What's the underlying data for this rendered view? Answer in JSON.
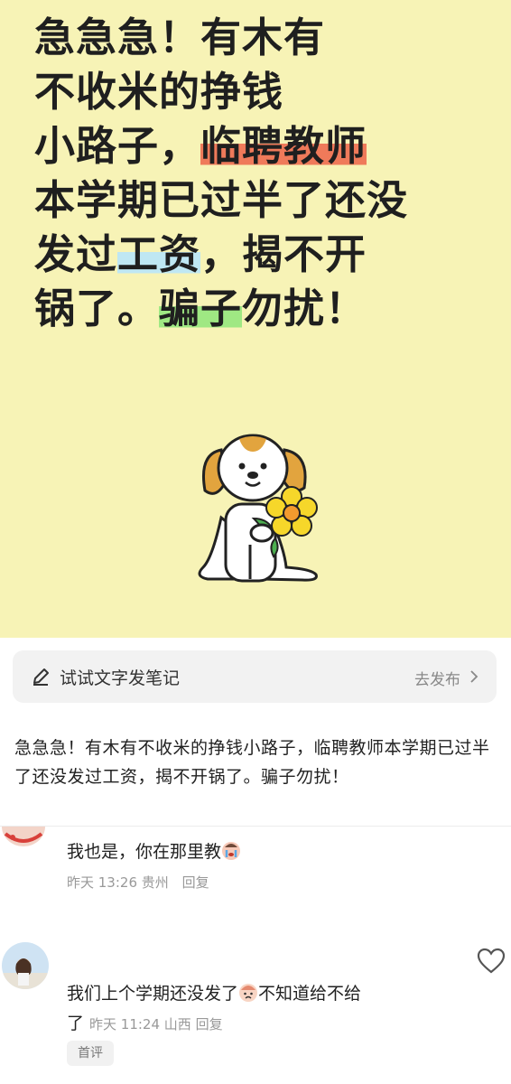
{
  "poster": {
    "line1": "急急急！有木有",
    "line2": "不收米的挣钱",
    "line3_plain": "小路子，",
    "line3_highlight": "临聘教师",
    "line4": "本学期已过半了还没",
    "line5_pre": "发过",
    "line5_highlight": "工资",
    "line5_post": "，揭不开",
    "line6_pre": "锅了。",
    "line6_highlight": "骗子",
    "line6_post": "勿扰！",
    "colors": {
      "background": "#f7f3b6",
      "orange_highlight": "#ef7a5a",
      "blue_highlight": "#bfe7f3",
      "green_highlight": "#9fe883"
    },
    "illustration": "dog-holding-sunflower"
  },
  "note_bar": {
    "icon": "pen-icon",
    "label": "试试文字发笔记",
    "action": "去发布",
    "action_icon": "chevron-right-icon"
  },
  "caption": "急急急！有木有不收米的挣钱小路子，临聘教师本学期已过半了还没发过工资，揭不开锅了。骗子勿扰！",
  "comments": [
    {
      "text": "我也是，你在那里教",
      "emoji": "crying-face-emoji",
      "time": "昨天 13:26",
      "location": "贵州",
      "reply": "回复"
    },
    {
      "text_line1": "我们上个学期还没发了",
      "emoji": "sad-face-emoji",
      "text_line1_post": "不知道给不给",
      "text_line2": "了",
      "time": "昨天 11:24",
      "location": "山西",
      "reply": "回复",
      "badge": "首评",
      "like_icon": "heart-icon"
    }
  ]
}
